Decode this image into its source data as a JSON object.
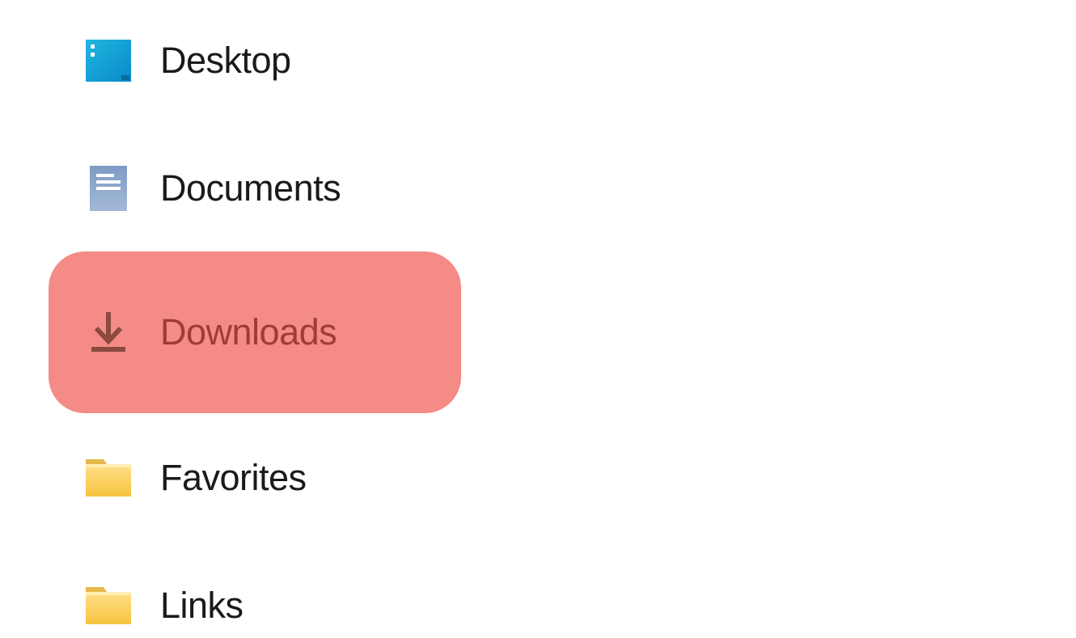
{
  "nav": {
    "items": [
      {
        "label": "Desktop",
        "icon": "desktop-icon",
        "highlighted": false
      },
      {
        "label": "Documents",
        "icon": "documents-icon",
        "highlighted": false
      },
      {
        "label": "Downloads",
        "icon": "downloads-icon",
        "highlighted": true
      },
      {
        "label": "Favorites",
        "icon": "folder-icon",
        "highlighted": false
      },
      {
        "label": "Links",
        "icon": "folder-icon",
        "highlighted": false
      }
    ]
  },
  "colors": {
    "highlight_bg": "#f48b87",
    "highlight_fg": "#9e3c36",
    "text": "#1a1a1a"
  }
}
